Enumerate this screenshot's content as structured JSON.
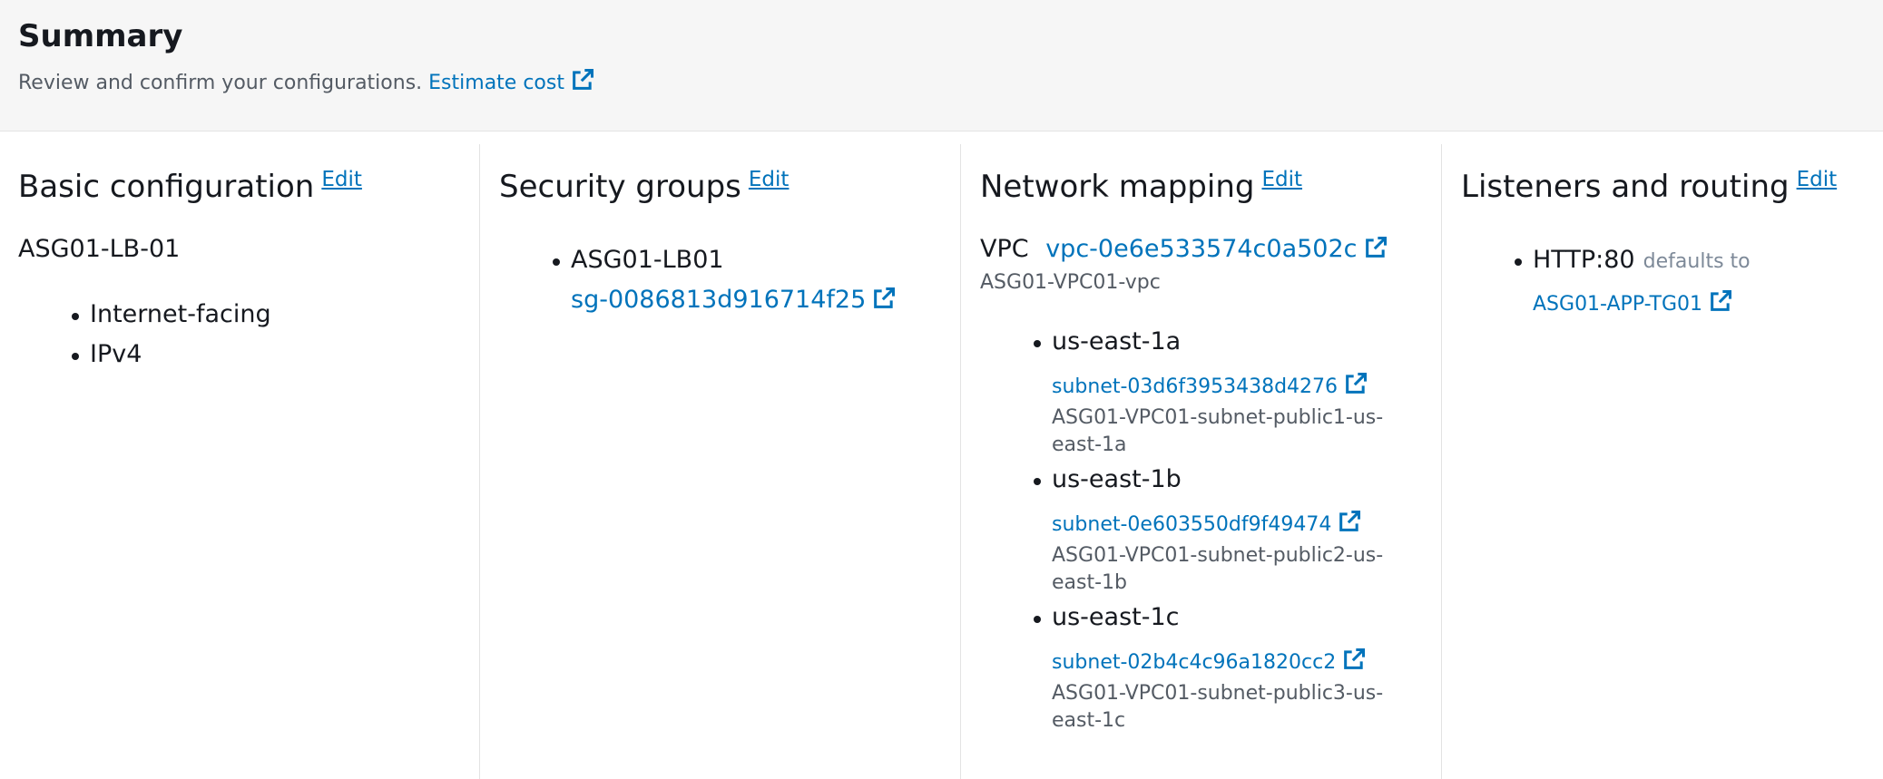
{
  "summary": {
    "title": "Summary",
    "description": "Review and confirm your configurations.",
    "estimate_cost": "Estimate cost"
  },
  "edit_label": "Edit",
  "basic": {
    "heading": "Basic configuration",
    "name": "ASG01-LB-01",
    "items": [
      "Internet-facing",
      "IPv4"
    ]
  },
  "security": {
    "heading": "Security groups",
    "group_name": "ASG01-LB01",
    "group_id": "sg-0086813d916714f25"
  },
  "network": {
    "heading": "Network mapping",
    "vpc_label": "VPC",
    "vpc_id": "vpc-0e6e533574c0a502c",
    "vpc_name": "ASG01-VPC01-vpc",
    "zones": [
      {
        "az": "us-east-1a",
        "subnet_id": "subnet-03d6f3953438d4276",
        "subnet_name_1": "ASG01-VPC01-subnet-public1-us-",
        "subnet_name_2": "east-1a"
      },
      {
        "az": "us-east-1b",
        "subnet_id": "subnet-0e603550df9f49474",
        "subnet_name_1": "ASG01-VPC01-subnet-public2-us-",
        "subnet_name_2": "east-1b"
      },
      {
        "az": "us-east-1c",
        "subnet_id": "subnet-02b4c4c96a1820cc2",
        "subnet_name_1": "ASG01-VPC01-subnet-public3-us-",
        "subnet_name_2": "east-1c"
      }
    ]
  },
  "listeners": {
    "heading": "Listeners and routing",
    "listener": "HTTP:80",
    "defaults_to": "defaults to",
    "target_group": "ASG01-APP-TG01"
  },
  "colors": {
    "link": "#0073bb",
    "text": "#16191f",
    "muted": "#545b64",
    "header_bg": "#f6f6f6"
  },
  "icons": [
    "external-link-icon"
  ]
}
